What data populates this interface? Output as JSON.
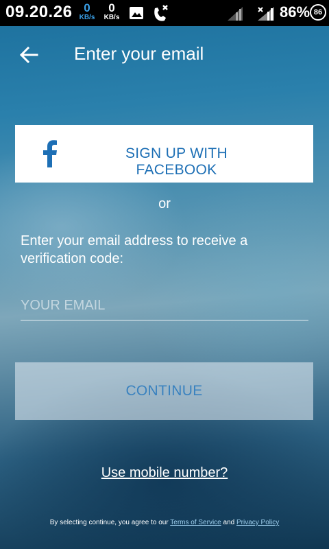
{
  "status_bar": {
    "time": "09.20.26",
    "upload_speed": "0",
    "upload_unit": "KB/s",
    "download_speed": "0",
    "download_unit": "KB/s",
    "battery_percent": "86%",
    "notification_badge": "86",
    "icons": [
      "image-icon",
      "missed-call-icon",
      "signal-icon",
      "signal-no-data-icon"
    ]
  },
  "header": {
    "title": "Enter your email",
    "back_icon": "arrow-left-icon"
  },
  "facebook_button": {
    "label": "SIGN UP WITH FACEBOOK",
    "icon": "facebook-f-icon",
    "brand_color": "#1d6fb5"
  },
  "separator": "or",
  "instruction": "Enter your email address to receive a verification code:",
  "email_field": {
    "placeholder": "YOUR EMAIL",
    "value": ""
  },
  "continue_button": {
    "label": "CONTINUE"
  },
  "mobile_link": "Use mobile number?",
  "footer": {
    "prefix": "By selecting continue, you agree to our",
    "terms_label": "Terms of Service",
    "conjunction": "and",
    "privacy_label": "Privacy Policy"
  }
}
